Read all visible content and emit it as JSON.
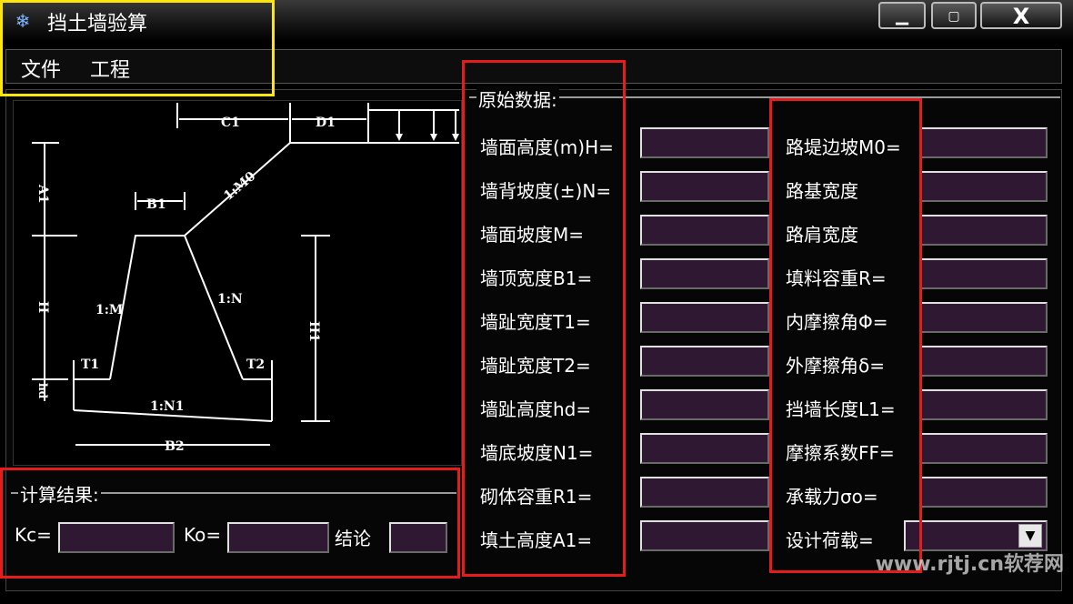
{
  "window": {
    "title": "挡土墙验算",
    "icon": "gear-snowflake-icon",
    "buttons": {
      "minimize": "▁",
      "maximize": "▢",
      "close": "X"
    }
  },
  "menu": [
    "文件",
    "工程"
  ],
  "diagram": {
    "labels": {
      "c1": "C1",
      "d1": "D1",
      "b1": "B1",
      "m0": "1:M0",
      "a1": "A1",
      "h": "H",
      "h1": "H1",
      "m": "1:M",
      "n": "1:N",
      "n1": "1:N1",
      "t1": "T1",
      "t2": "T2",
      "b2": "B2",
      "hd": "hd"
    }
  },
  "results": {
    "title": "计算结果:",
    "kc_label": "Kc=",
    "kc_value": "",
    "ko_label": "Ko=",
    "ko_value": "",
    "conclusion_label": "结论",
    "conclusion_value": ""
  },
  "raw_data": {
    "title": "原始数据:",
    "left": [
      {
        "label": "墙面高度(m)H=",
        "value": ""
      },
      {
        "label": "墙背坡度(±)N=",
        "value": ""
      },
      {
        "label": "墙面坡度M=",
        "value": ""
      },
      {
        "label": "墙顶宽度B1=",
        "value": ""
      },
      {
        "label": "墙趾宽度T1=",
        "value": ""
      },
      {
        "label": "墙趾宽度T2=",
        "value": ""
      },
      {
        "label": "墙趾高度hd=",
        "value": ""
      },
      {
        "label": "墙底坡度N1=",
        "value": ""
      },
      {
        "label": "砌体容重R1=",
        "value": ""
      },
      {
        "label": "填土高度A1=",
        "value": ""
      }
    ],
    "right": [
      {
        "label": "路堤边坡M0=",
        "value": ""
      },
      {
        "label": "路基宽度",
        "value": ""
      },
      {
        "label": "路肩宽度",
        "value": ""
      },
      {
        "label": "填料容重R=",
        "value": ""
      },
      {
        "label": "内摩擦角Φ=",
        "value": ""
      },
      {
        "label": "外摩擦角δ=",
        "value": ""
      },
      {
        "label": "挡墙长度L1=",
        "value": ""
      },
      {
        "label": "摩擦系数FF=",
        "value": ""
      },
      {
        "label": "承载力σo=",
        "value": ""
      },
      {
        "label": "设计荷载=",
        "value": ""
      }
    ]
  },
  "watermark": "www.rjtj.cn软荐网",
  "colors": {
    "highlight_red": "#e51c1c",
    "highlight_yellow": "#ffe60a",
    "field_bg": "#2e1832"
  }
}
